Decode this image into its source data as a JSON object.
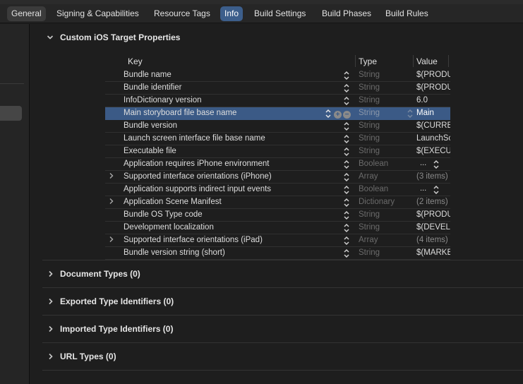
{
  "tabs": [
    {
      "label": "General"
    },
    {
      "label": "Signing & Capabilities"
    },
    {
      "label": "Resource Tags"
    },
    {
      "label": "Info"
    },
    {
      "label": "Build Settings"
    },
    {
      "label": "Build Phases"
    },
    {
      "label": "Build Rules"
    }
  ],
  "active_tab": "Info",
  "custom_properties": {
    "title": "Custom iOS Target Properties",
    "columns": {
      "key": "Key",
      "type": "Type",
      "value": "Value"
    },
    "rows": [
      {
        "key": "Bundle name",
        "type": "String",
        "value": "$(PRODUCT_NAME)",
        "expandable": false
      },
      {
        "key": "Bundle identifier",
        "type": "String",
        "value": "$(PRODUCT_BUNDLE_IDENTIFIER)",
        "expandable": false
      },
      {
        "key": "InfoDictionary version",
        "type": "String",
        "value": "6.0",
        "expandable": false
      },
      {
        "key": "Main storyboard file base name",
        "type": "String",
        "value": "Main",
        "expandable": false,
        "selected": true
      },
      {
        "key": "Bundle version",
        "type": "String",
        "value": "$(CURRENT_PROJECT_VERSION)",
        "expandable": false
      },
      {
        "key": "Launch screen interface file base name",
        "type": "String",
        "value": "LaunchScreen",
        "expandable": false
      },
      {
        "key": "Executable file",
        "type": "String",
        "value": "$(EXECUTABLE_NAME)",
        "expandable": false
      },
      {
        "key": "Application requires iPhone environment",
        "type": "Boolean",
        "value": "...",
        "expandable": false
      },
      {
        "key": "Supported interface orientations (iPhone)",
        "type": "Array",
        "value": "(3 items)",
        "expandable": true
      },
      {
        "key": "Application supports indirect input events",
        "type": "Boolean",
        "value": "...",
        "expandable": false
      },
      {
        "key": "Application Scene Manifest",
        "type": "Dictionary",
        "value": "(2 items)",
        "expandable": true
      },
      {
        "key": "Bundle OS Type code",
        "type": "String",
        "value": "$(PRODUCT_BUNDLE_PACKAGE_TYPE)",
        "expandable": false
      },
      {
        "key": "Development localization",
        "type": "String",
        "value": "$(DEVELOPMENT_LANGUAGE)",
        "expandable": false
      },
      {
        "key": "Supported interface orientations (iPad)",
        "type": "Array",
        "value": "(4 items)",
        "expandable": true
      },
      {
        "key": "Bundle version string (short)",
        "type": "String",
        "value": "$(MARKETING_VERSION)",
        "expandable": false
      }
    ]
  },
  "sections": [
    {
      "title": "Document Types (0)"
    },
    {
      "title": "Exported Type Identifiers (0)"
    },
    {
      "title": "Imported Type Identifiers (0)"
    },
    {
      "title": "URL Types (0)"
    }
  ]
}
